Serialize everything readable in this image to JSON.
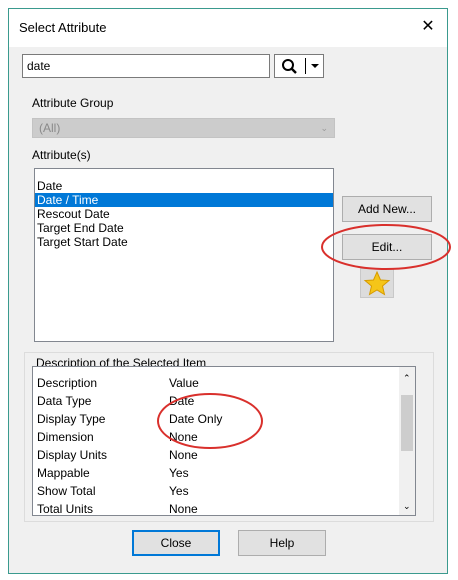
{
  "window": {
    "title": "Select Attribute"
  },
  "search": {
    "value": "date"
  },
  "attribute_group": {
    "label": "Attribute Group",
    "selected": "(All)"
  },
  "attributes": {
    "label": "Attribute(s)",
    "items": [
      "Date",
      "Date / Time",
      "Rescout Date",
      "Target End Date",
      "Target Start Date"
    ],
    "selected_index": 1
  },
  "buttons": {
    "add_new": "Add New...",
    "edit": "Edit...",
    "close": "Close",
    "help": "Help"
  },
  "description": {
    "group_label": "Description of the Selected Item",
    "columns": [
      "Description",
      "Value"
    ],
    "rows": [
      [
        "Data Type",
        "Date"
      ],
      [
        "Display Type",
        "Date Only"
      ],
      [
        "Dimension",
        "None"
      ],
      [
        "Display Units",
        "None"
      ],
      [
        "Mappable",
        "Yes"
      ],
      [
        "Show Total",
        "Yes"
      ],
      [
        "Total Units",
        "None"
      ]
    ]
  },
  "colors": {
    "selection": "#0078d7",
    "annotation": "#d9302c",
    "star": "#f5c518"
  }
}
